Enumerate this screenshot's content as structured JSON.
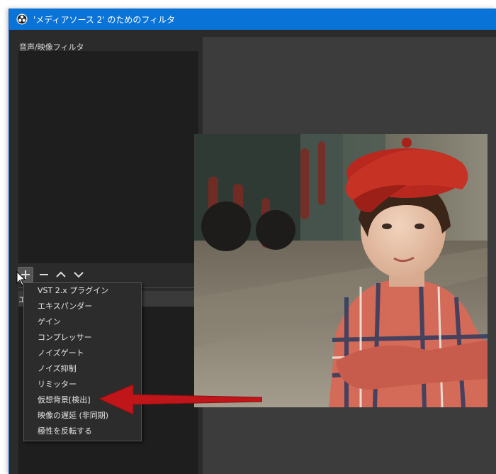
{
  "window": {
    "title": "'メディアソース 2' のためのフィルタ",
    "title_icon": "obs-logo-icon",
    "titlebar_color": "#0a73d7",
    "background_color": "#2b2b2b"
  },
  "filters_panel": {
    "label": "音声/映像フィルタ"
  },
  "toolbar": {
    "buttons": [
      "add-icon",
      "minus-icon",
      "chevron-up-icon",
      "chevron-down-icon"
    ]
  },
  "effects_panel": {
    "label_visible": "エ"
  },
  "context_menu": {
    "items": [
      "VST 2.x プラグイン",
      "エキスパンダー",
      "ゲイン",
      "コンプレッサー",
      "ノイズゲート",
      "ノイズ抑制",
      "リミッター",
      "仮想背景[検出]",
      "映像の遅延 (非同期)",
      "極性を反転する"
    ]
  },
  "annotation": {
    "arrow_color": "#c0161a",
    "points_to": "仮想背景[検出]"
  },
  "preview": {
    "content": "photo of a child in a red cap and plaid shirt in front of a train"
  }
}
